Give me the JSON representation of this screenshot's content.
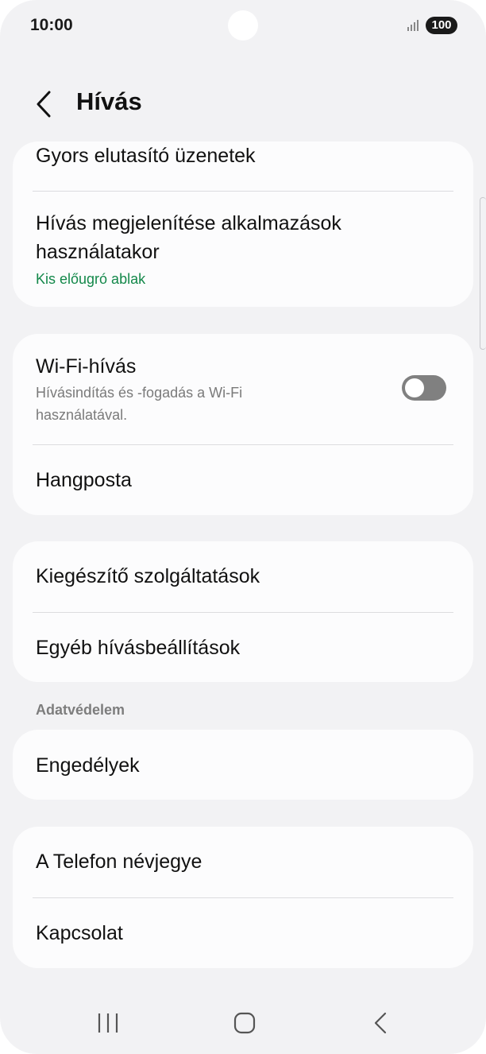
{
  "status_bar": {
    "time": "10:00",
    "battery": "100",
    "icons": [
      "signal-icon",
      "battery-icon"
    ]
  },
  "header": {
    "title": "Hívás",
    "back_icon": "chevron-left-icon"
  },
  "card1": {
    "item1_title": "Gyors elutasító üzenetek",
    "item2_title_line1": "Hívás megjelenítése alkalmazások",
    "item2_title_line2": "használatakor",
    "item2_subtitle": "Kis előugró ablak"
  },
  "card2": {
    "wifi_title": "Wi-Fi-hívás",
    "wifi_sub_line1": "Hívásindítás és -fogadás a Wi-Fi",
    "wifi_sub_line2": "használatával.",
    "wifi_toggle_on": false,
    "voicemail_title": "Hangposta"
  },
  "card3": {
    "item1_title": "Kiegészítő szolgáltatások",
    "item2_title": "Egyéb hívásbeállítások"
  },
  "privacy": {
    "section_label": "Adatvédelem",
    "permissions_title": "Engedélyek"
  },
  "card5": {
    "item1_title": "A Telefon névjegye",
    "item2_title": "Kapcsolat"
  },
  "nav_bar": {
    "buttons": [
      "recent-apps-icon",
      "home-icon",
      "back-icon"
    ]
  },
  "colors": {
    "accent_green": "#13884a",
    "background": "#f2f2f4",
    "card": "#fcfcfd",
    "toggle_off": "#808080"
  }
}
